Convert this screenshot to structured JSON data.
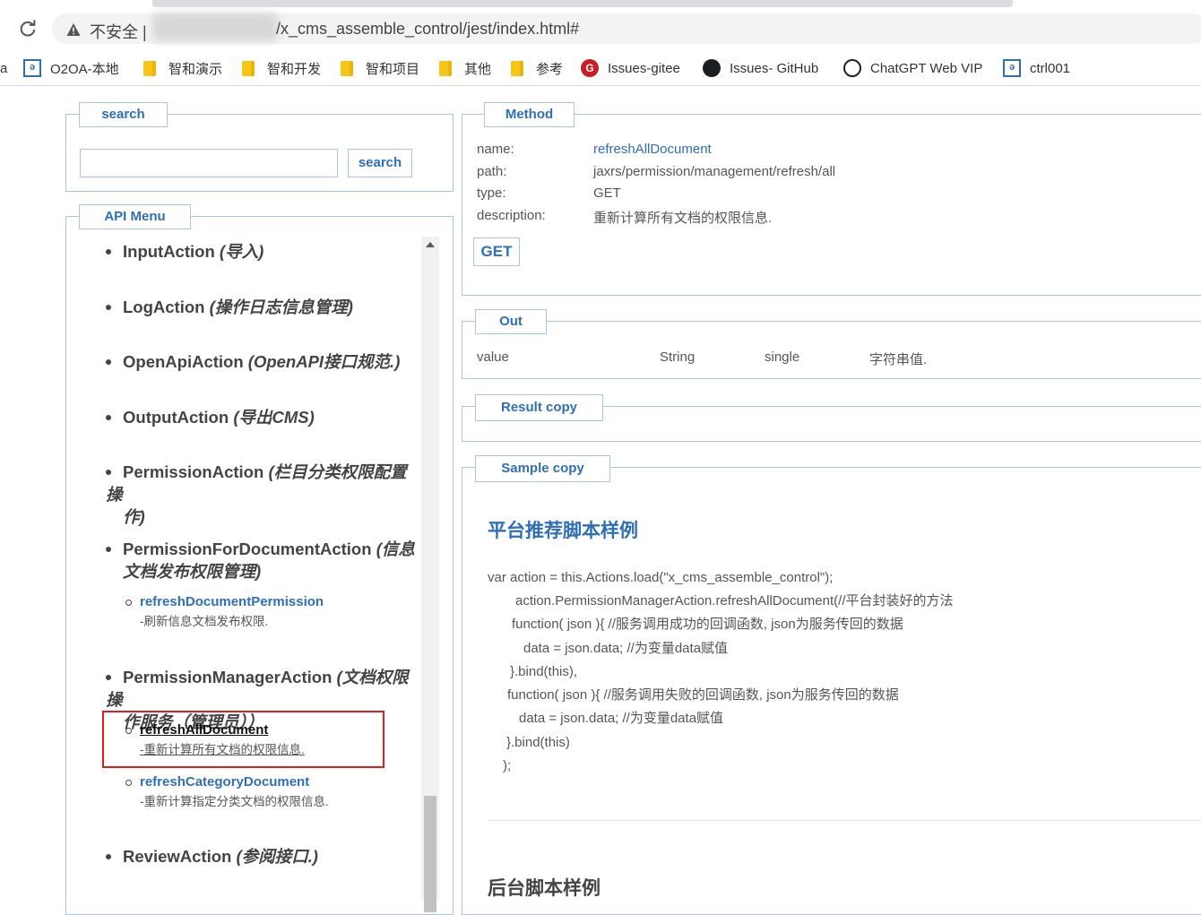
{
  "browser": {
    "insecure_label": "不安全 |",
    "url_path": "/x_cms_assemble_control/jest/index.html#",
    "bookmarks": [
      {
        "label": "a",
        "icon": "partial"
      },
      {
        "label": "O2OA-本地",
        "icon": "o2oa-icon"
      },
      {
        "label": "智和演示",
        "icon": "folder-icon"
      },
      {
        "label": "智和开发",
        "icon": "folder-icon"
      },
      {
        "label": "智和项目",
        "icon": "folder-icon"
      },
      {
        "label": "其他",
        "icon": "folder-icon"
      },
      {
        "label": "参考",
        "icon": "folder-icon"
      },
      {
        "label": "Issues-gitee",
        "icon": "gitee-icon"
      },
      {
        "label": "Issues- GitHub",
        "icon": "github-icon"
      },
      {
        "label": "ChatGPT Web VIP",
        "icon": "openai-icon"
      },
      {
        "label": "ctrl001",
        "icon": "o2oa-icon"
      }
    ]
  },
  "search": {
    "legend": "search",
    "button": "search",
    "value": ""
  },
  "api_menu": {
    "legend": "API Menu",
    "items": [
      {
        "name": "InputAction",
        "desc": "(导入)"
      },
      {
        "name": "LogAction",
        "desc": "(操作日志信息管理)"
      },
      {
        "name": "OpenApiAction",
        "desc": "(OpenAPI接口规范.)"
      },
      {
        "name": "OutputAction",
        "desc": "(导出CMS)"
      },
      {
        "name": "PermissionAction",
        "desc": "(栏目分类权限配置操",
        "desc2": "作)"
      },
      {
        "name": "PermissionForDocumentAction",
        "desc": "(信息",
        "desc2": "文档发布权限管理)"
      },
      {
        "name": "PermissionManagerAction",
        "desc": "(文档权限操",
        "desc2": "作服务（管理员））"
      },
      {
        "name": "ReviewAction",
        "desc": "(参阅接口.)"
      }
    ],
    "subs": [
      {
        "name": "refreshDocumentPermission",
        "desc": "-刷新信息文档发布权限."
      },
      {
        "name": "refreshAllDocument",
        "desc": "-重新计算所有文档的权限信息."
      },
      {
        "name": "refreshCategoryDocument",
        "desc": "-重新计算指定分类文档的权限信息."
      }
    ]
  },
  "method": {
    "legend": "Method",
    "name_label": "name:",
    "name_value": "refreshAllDocument",
    "path_label": "path:",
    "path_value": "jaxrs/permission/management/refresh/all",
    "type_label": "type:",
    "type_value": "GET",
    "description_label": "description:",
    "description_value": "重新计算所有文档的权限信息.",
    "button": "GET"
  },
  "out": {
    "legend": "Out",
    "row": {
      "name": "value",
      "type": "String",
      "multi": "single",
      "desc": "字符串值."
    }
  },
  "result": {
    "legend": "Result copy"
  },
  "sample": {
    "legend": "Sample copy",
    "title": "平台推荐脚本样例",
    "code": [
      "var action = this.Actions.load(\"x_cms_assemble_control\");",
      "action.PermissionManagerAction.refreshAllDocument(//平台封装好的方法",
      "function( json ){ //服务调用成功的回调函数, json为服务传回的数据",
      "data = json.data; //为变量data赋值",
      "}.bind(this),",
      "function( json ){ //服务调用失败的回调函数, json为服务传回的数据",
      "data = json.data; //为变量data赋值",
      "}.bind(this)",
      ");"
    ],
    "title2": "后台脚本样例"
  }
}
